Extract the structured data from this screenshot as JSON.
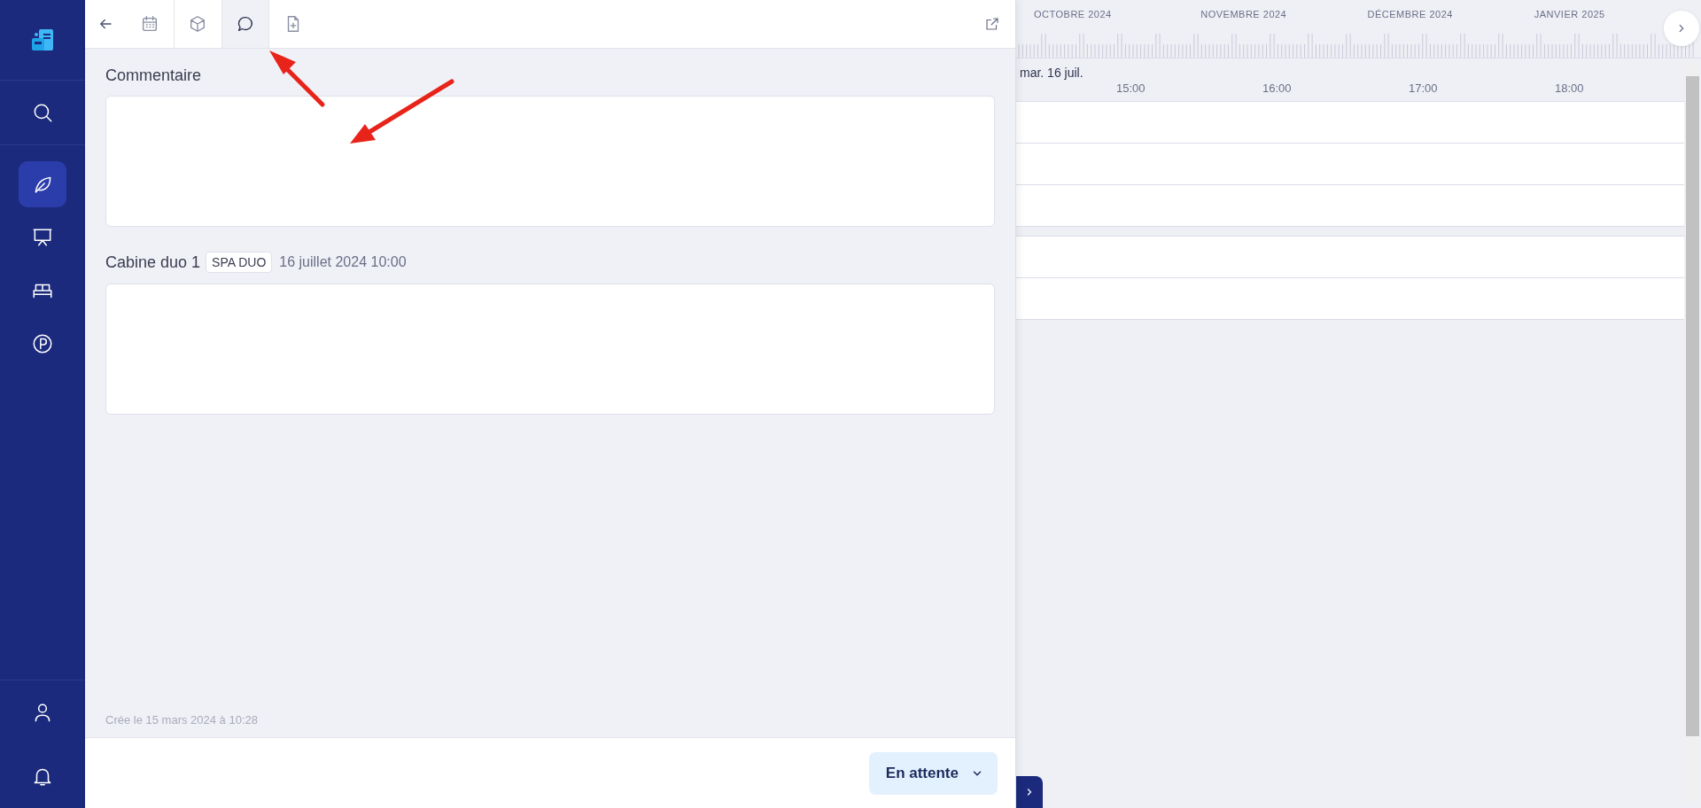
{
  "sidebar": {
    "top_items": [
      {
        "kind": "search",
        "selected": false
      }
    ],
    "items": [
      {
        "kind": "leaf",
        "selected": true
      },
      {
        "kind": "presentation",
        "selected": false
      },
      {
        "kind": "bed",
        "selected": false
      },
      {
        "kind": "parking",
        "selected": false
      }
    ],
    "bottom_items": [
      {
        "kind": "user",
        "selected": false
      },
      {
        "kind": "bell",
        "selected": false
      }
    ]
  },
  "toolbar": {
    "tabs": [
      {
        "kind": "calendar",
        "selected": false
      },
      {
        "kind": "cube",
        "selected": false
      },
      {
        "kind": "comment",
        "selected": true
      },
      {
        "kind": "file",
        "selected": false
      }
    ]
  },
  "comment": {
    "label": "Commentaire"
  },
  "cabin": {
    "name": "Cabine duo 1",
    "tag": "SPA DUO",
    "date": "16 juillet 2024 10:00"
  },
  "created": "Crée le 15 mars 2024 à 10:28",
  "status_button": "En attente",
  "timeline": {
    "months": [
      "OCTOBRE 2024",
      "NOVEMBRE 2024",
      "DÉCEMBRE 2024",
      "JANVIER 2025"
    ],
    "day": "mar. 16 juil.",
    "hours": [
      "15:00",
      "16:00",
      "17:00",
      "18:00"
    ]
  }
}
